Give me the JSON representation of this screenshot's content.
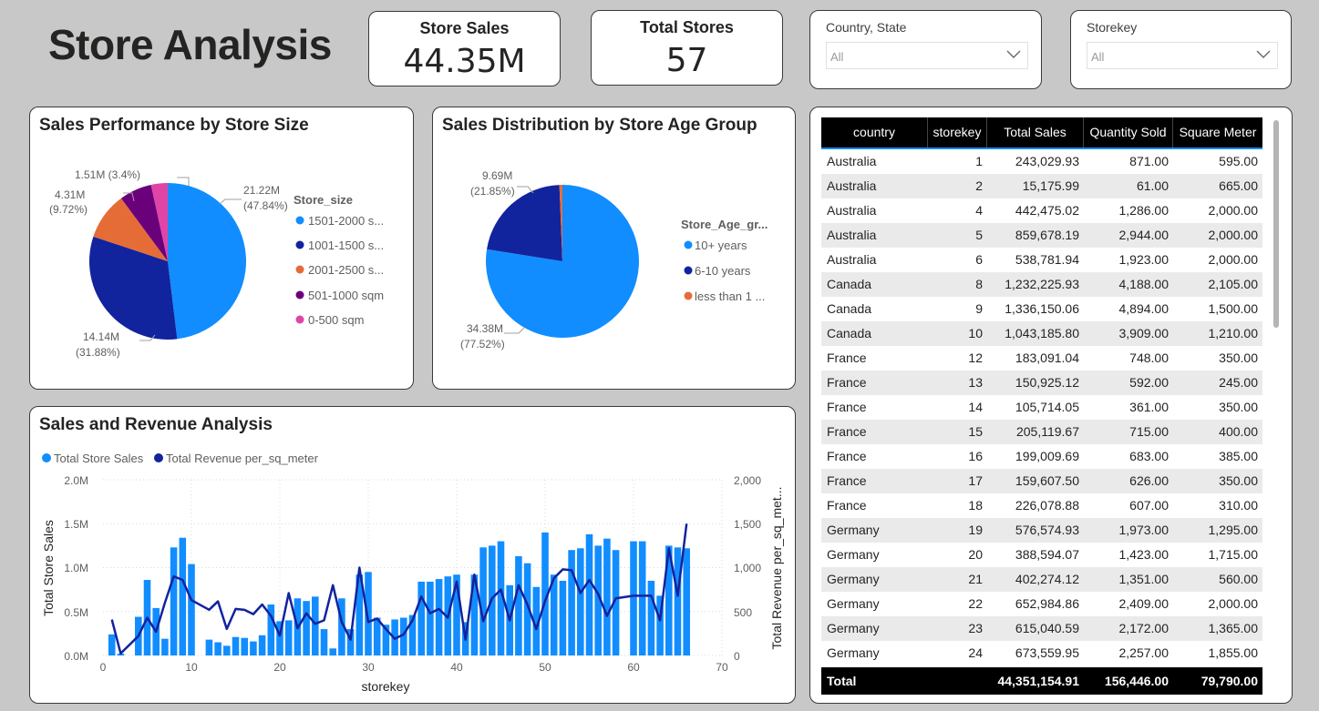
{
  "page_title": "Store Analysis",
  "kpis": {
    "store_sales": {
      "title": "Store Sales",
      "value": "44.35M"
    },
    "total_stores": {
      "title": "Total Stores",
      "value": "57"
    }
  },
  "slicers": {
    "country_state": {
      "title": "Country, State",
      "value": "All"
    },
    "storekey": {
      "title": "Storekey",
      "value": "All"
    }
  },
  "colors": {
    "blue": "#118dff",
    "dark_blue": "#12239e",
    "orange": "#e66c37",
    "purple": "#6b007b",
    "pink": "#e044a7"
  },
  "store_size_chart": {
    "title": "Sales Performance by Store Size",
    "legend_title": "Store_size",
    "legend": [
      "1501-2000 s...",
      "1001-1500 s...",
      "2001-2500 s...",
      "501-1000 sqm",
      "0-500 sqm"
    ],
    "labels": {
      "l1": "21.22M",
      "l1b": "(47.84%)",
      "l2": "14.14M",
      "l2b": "(31.88%)",
      "l3": "4.31M",
      "l3b": "(9.72%)",
      "l4": "1.51M (3.4%)"
    }
  },
  "store_age_chart": {
    "title": "Sales Distribution by Store Age Group",
    "legend_title": "Store_Age_gr...",
    "legend": [
      "10+ years",
      "6-10 years",
      "less than 1 ..."
    ],
    "labels": {
      "l1": "9.69M",
      "l1b": "(21.85%)",
      "l2": "34.38M",
      "l2b": "(77.52%)"
    }
  },
  "combo_chart": {
    "title": "Sales and Revenue Analysis",
    "legend": [
      "Total Store Sales",
      "Total Revenue per_sq_meter"
    ],
    "xlabel": "storekey",
    "ylabel_left": "Total Store Sales",
    "ylabel_right": "Total Revenue per_sq_met...",
    "left_ticks": [
      "0.0M",
      "0.5M",
      "1.0M",
      "1.5M",
      "2.0M"
    ],
    "right_ticks": [
      "0",
      "500",
      "1,000",
      "1,500",
      "2,000"
    ],
    "x_ticks": [
      "0",
      "10",
      "20",
      "30",
      "40",
      "50",
      "60",
      "70"
    ]
  },
  "chart_data": [
    {
      "type": "pie",
      "title": "Sales Performance by Store Size",
      "legend_title": "Store_size",
      "categories": [
        "1501-2000 s...",
        "1001-1500 s...",
        "2001-2500 s...",
        "501-1000 sqm",
        "0-500 sqm"
      ],
      "values": [
        21.22,
        14.14,
        4.31,
        2.96,
        1.51
      ],
      "percent": [
        47.84,
        31.88,
        9.72,
        6.67,
        3.4
      ],
      "legend_placement": "right"
    },
    {
      "type": "pie",
      "title": "Sales Distribution by Store Age Group",
      "legend_title": "Store_Age_gr...",
      "categories": [
        "10+ years",
        "6-10 years",
        "less than 1 ..."
      ],
      "values": [
        34.38,
        9.69,
        0.28
      ],
      "percent": [
        77.52,
        21.85,
        0.63
      ],
      "legend_placement": "right"
    },
    {
      "type": "bar",
      "title": "Sales and Revenue Analysis",
      "xlabel": "storekey",
      "ylabel": "Total Store Sales",
      "y2label": "Total Revenue per_sq_met...",
      "xlim": [
        0,
        70
      ],
      "ylim": [
        0,
        2.0
      ],
      "y2lim": [
        0,
        2000
      ],
      "grid": true,
      "legend_placement": "top-left",
      "x": [
        1,
        2,
        4,
        5,
        6,
        7,
        8,
        9,
        10,
        12,
        13,
        14,
        15,
        16,
        17,
        18,
        19,
        20,
        21,
        22,
        23,
        24,
        25,
        26,
        27,
        28,
        29,
        30,
        31,
        32,
        33,
        34,
        35,
        36,
        37,
        38,
        39,
        40,
        41,
        42,
        43,
        44,
        45,
        46,
        47,
        48,
        49,
        50,
        51,
        52,
        53,
        54,
        55,
        56,
        57,
        58,
        60,
        61,
        62,
        63,
        64,
        65,
        66
      ],
      "series": [
        {
          "name": "Total Store Sales",
          "type": "bar",
          "unit": "M",
          "values": [
            0.24,
            0.02,
            0.44,
            0.86,
            0.54,
            0.19,
            1.23,
            1.34,
            1.04,
            0.18,
            0.15,
            0.11,
            0.21,
            0.2,
            0.16,
            0.23,
            0.58,
            0.39,
            0.4,
            0.65,
            0.62,
            0.67,
            0.3,
            0.08,
            0.65,
            0.3,
            0.92,
            0.95,
            0.43,
            0.35,
            0.41,
            0.43,
            0.46,
            0.84,
            0.84,
            0.87,
            0.9,
            0.92,
            0.38,
            0.92,
            1.23,
            1.25,
            1.3,
            0.8,
            1.13,
            1.05,
            0.78,
            1.4,
            0.92,
            0.85,
            1.2,
            1.22,
            1.38,
            1.25,
            1.33,
            1.2,
            1.3,
            1.3,
            0.85,
            0.68,
            1.25,
            1.23,
            1.22
          ]
        },
        {
          "name": "Total Revenue per_sq_meter",
          "type": "line",
          "values": [
            409,
            23,
            221,
            430,
            270,
            600,
            900,
            860,
            630,
            520,
            616,
            302,
            530,
            520,
            470,
            580,
            450,
            227,
            710,
            310,
            480,
            360,
            400,
            800,
            380,
            180,
            1000,
            380,
            420,
            300,
            190,
            240,
            400,
            670,
            480,
            530,
            430,
            840,
            180,
            920,
            390,
            650,
            750,
            400,
            800,
            580,
            300,
            620,
            880,
            980,
            970,
            710,
            860,
            700,
            450,
            650,
            680,
            680,
            680,
            400,
            1220,
            680,
            1500
          ]
        }
      ]
    }
  ],
  "table": {
    "headers": [
      "country",
      "storekey",
      "Total Sales",
      "Quantity Sold",
      "Square Meter"
    ],
    "rows": [
      [
        "Australia",
        "1",
        "243,029.93",
        "871.00",
        "595.00"
      ],
      [
        "Australia",
        "2",
        "15,175.99",
        "61.00",
        "665.00"
      ],
      [
        "Australia",
        "4",
        "442,475.02",
        "1,286.00",
        "2,000.00"
      ],
      [
        "Australia",
        "5",
        "859,678.19",
        "2,944.00",
        "2,000.00"
      ],
      [
        "Australia",
        "6",
        "538,781.94",
        "1,923.00",
        "2,000.00"
      ],
      [
        "Canada",
        "8",
        "1,232,225.93",
        "4,188.00",
        "2,105.00"
      ],
      [
        "Canada",
        "9",
        "1,336,150.06",
        "4,894.00",
        "1,500.00"
      ],
      [
        "Canada",
        "10",
        "1,043,185.80",
        "3,909.00",
        "1,210.00"
      ],
      [
        "France",
        "12",
        "183,091.04",
        "748.00",
        "350.00"
      ],
      [
        "France",
        "13",
        "150,925.12",
        "592.00",
        "245.00"
      ],
      [
        "France",
        "14",
        "105,714.05",
        "361.00",
        "350.00"
      ],
      [
        "France",
        "15",
        "205,119.67",
        "715.00",
        "400.00"
      ],
      [
        "France",
        "16",
        "199,009.69",
        "683.00",
        "385.00"
      ],
      [
        "France",
        "17",
        "159,607.50",
        "626.00",
        "350.00"
      ],
      [
        "France",
        "18",
        "226,078.88",
        "607.00",
        "310.00"
      ],
      [
        "Germany",
        "19",
        "576,574.93",
        "1,973.00",
        "1,295.00"
      ],
      [
        "Germany",
        "20",
        "388,594.07",
        "1,423.00",
        "1,715.00"
      ],
      [
        "Germany",
        "21",
        "402,274.12",
        "1,351.00",
        "560.00"
      ],
      [
        "Germany",
        "22",
        "652,984.86",
        "2,409.00",
        "2,000.00"
      ],
      [
        "Germany",
        "23",
        "615,040.59",
        "2,172.00",
        "1,365.00"
      ],
      [
        "Germany",
        "24",
        "673,559.95",
        "2,257.00",
        "1,855.00"
      ]
    ],
    "total": [
      "Total",
      "",
      "44,351,154.91",
      "156,446.00",
      "79,790.00"
    ]
  }
}
